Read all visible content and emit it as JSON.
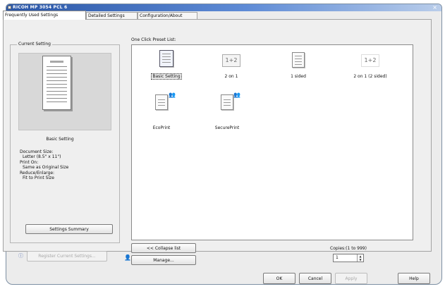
{
  "window": {
    "title": "RICOH MP 3054 PCL 6"
  },
  "tabs": [
    {
      "label": "Frequently Used Settings",
      "active": true
    },
    {
      "label": "Detailed Settings",
      "active": false
    },
    {
      "label": "Configuration/About",
      "active": false
    }
  ],
  "current_setting": {
    "group_title": "Current Setting",
    "name": "Basic Setting",
    "details": [
      {
        "label": "Document Size:",
        "value": "Letter (8.5\" x 11\")"
      },
      {
        "label": "Print On:",
        "value": "Same as Original Size"
      },
      {
        "label": "Reduce/Enlarge:",
        "value": "Fit to Print Size"
      }
    ],
    "summary_button": "Settings Summary",
    "register_button": "Register Current Settings..."
  },
  "presets": {
    "label": "One Click Preset List:",
    "items": [
      {
        "label": "Basic Setting",
        "icon": "document-stack-icon",
        "selected": true
      },
      {
        "label": "2 on 1",
        "icon": "two-on-one-icon",
        "glyph": "1+2",
        "selected": false
      },
      {
        "label": "1 sided",
        "icon": "single-page-icon",
        "selected": false
      },
      {
        "label": "2 on 1 (2 sided)",
        "icon": "two-on-one-duplex-icon",
        "glyph": "1+2",
        "selected": false
      },
      {
        "label": "EcoPrint",
        "icon": "eco-print-icon",
        "selected": false
      },
      {
        "label": "SecurePrint",
        "icon": "secure-print-icon",
        "selected": false
      }
    ],
    "collapse_button": "<< Collapse list",
    "manage_button": "Manage..."
  },
  "copies": {
    "label": "Copies:(1 to 999)",
    "value": "1"
  },
  "footer": {
    "ok": "OK",
    "cancel": "Cancel",
    "apply": "Apply",
    "help": "Help"
  }
}
